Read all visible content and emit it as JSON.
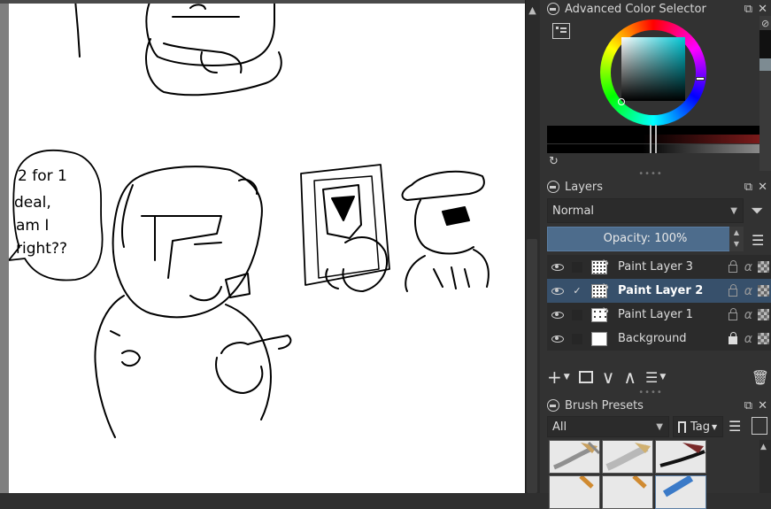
{
  "color_selector": {
    "title": "Advanced Color Selector",
    "hue_color": "#00c8d6"
  },
  "layers": {
    "title": "Layers",
    "blend_mode": "Normal",
    "opacity_label": "Opacity:  100%",
    "items": [
      {
        "name": "Paint Layer 3",
        "selected": false,
        "checked": false,
        "locked": false
      },
      {
        "name": "Paint Layer 2",
        "selected": true,
        "checked": true,
        "locked": false
      },
      {
        "name": "Paint Layer 1",
        "selected": false,
        "checked": false,
        "locked": false
      },
      {
        "name": "Background",
        "selected": false,
        "checked": false,
        "locked": true
      }
    ]
  },
  "brush_presets": {
    "title": "Brush Presets",
    "filter": "All",
    "tag_label": "Tag"
  },
  "canvas": {
    "speech_bubble_text": "2 for 1 deal, am I right??"
  },
  "icons": {
    "close": "✕",
    "float": "⧉",
    "check": "✓",
    "alpha": "α",
    "add": "+",
    "chevron_down": "∨",
    "chevron_up": "∧",
    "trash": "🗑"
  },
  "colors": {
    "accent": "#4d6c8c",
    "selected_row": "#37506b",
    "panel": "#323232"
  }
}
